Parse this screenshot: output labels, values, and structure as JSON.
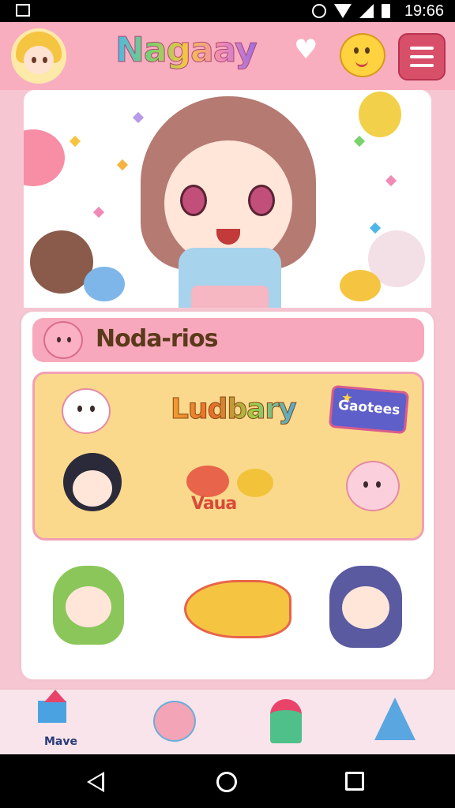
{
  "status_bar": {
    "time": "19:66"
  },
  "header": {
    "app_title": "Nagaay",
    "icons": [
      "avatar",
      "heart-icon",
      "chick-icon",
      "menu-icon"
    ]
  },
  "card": {
    "title": "Noda-rios",
    "panel": {
      "title": "Ludbary",
      "games_button": "Gaotees",
      "food_label": "Vaua"
    }
  },
  "bottom_nav": {
    "items": [
      {
        "label": "Mave",
        "icon": "move-icon"
      },
      {
        "label": "",
        "icon": "cookie-icon"
      },
      {
        "label": "",
        "icon": "popsicle-icon"
      },
      {
        "label": "",
        "icon": "wizard-hat-icon"
      }
    ]
  },
  "colors": {
    "header_bg": "#f9aebf",
    "accent_pink": "#d84f6a",
    "panel_yellow": "#fbd98c",
    "games_blue": "#5e5fc9"
  }
}
